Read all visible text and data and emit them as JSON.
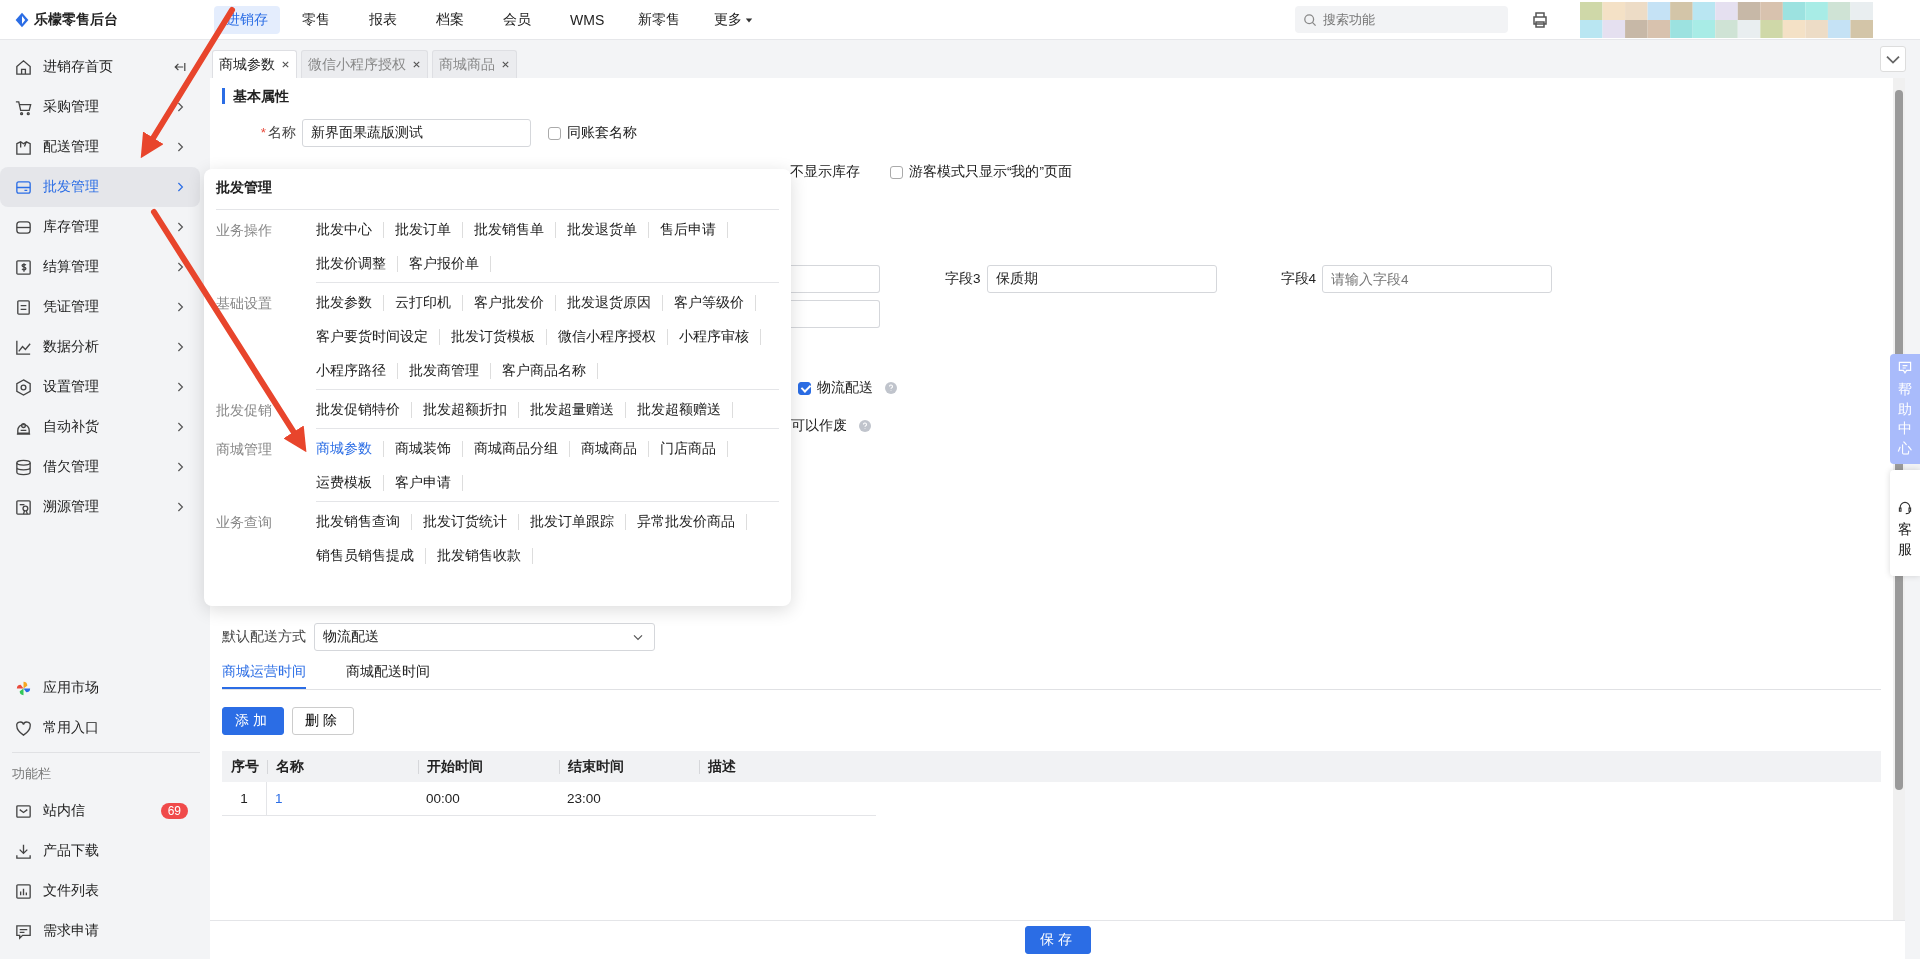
{
  "app": {
    "title": "乐檬零售后台"
  },
  "top_nav": [
    {
      "label": "进销存",
      "selected": true,
      "kind": "link"
    },
    {
      "label": "零售",
      "selected": false,
      "kind": "link"
    },
    {
      "label": "报表",
      "selected": false,
      "kind": "link"
    },
    {
      "label": "档案",
      "selected": false,
      "kind": "link"
    },
    {
      "label": "会员",
      "selected": false,
      "kind": "link"
    },
    {
      "label": "WMS",
      "selected": false,
      "kind": "link"
    },
    {
      "label": "新零售",
      "selected": false,
      "kind": "link"
    },
    {
      "label": "更多",
      "selected": false,
      "kind": "dropdown"
    }
  ],
  "search": {
    "placeholder": "搜索功能"
  },
  "sidebar": {
    "items": [
      {
        "label": "进销存首页",
        "selected": false
      },
      {
        "label": "采购管理",
        "selected": false
      },
      {
        "label": "配送管理",
        "selected": false
      },
      {
        "label": "批发管理",
        "selected": true
      },
      {
        "label": "库存管理",
        "selected": false
      },
      {
        "label": "结算管理",
        "selected": false
      },
      {
        "label": "凭证管理",
        "selected": false
      },
      {
        "label": "数据分析",
        "selected": false
      },
      {
        "label": "设置管理",
        "selected": false
      },
      {
        "label": "自动补货",
        "selected": false
      },
      {
        "label": "借欠管理",
        "selected": false
      },
      {
        "label": "溯源管理",
        "selected": false
      }
    ],
    "shortcuts": [
      {
        "label": "应用市场"
      },
      {
        "label": "常用入口"
      }
    ],
    "section_label": "功能栏",
    "tools": [
      {
        "label": "站内信",
        "badge": "69"
      },
      {
        "label": "产品下载"
      },
      {
        "label": "文件列表"
      },
      {
        "label": "需求申请"
      }
    ]
  },
  "page_tabs": [
    {
      "label": "商城参数",
      "selected": true
    },
    {
      "label": "微信小程序授权",
      "selected": false
    },
    {
      "label": "商城商品",
      "selected": false
    }
  ],
  "form": {
    "section_title": "基本属性",
    "name_field": {
      "label": "名称",
      "required_mark": "*",
      "value": "新界面果蔬版测试"
    },
    "same_name": {
      "label": "同账套名称",
      "checked": false
    },
    "hide_stock": {
      "label": "不显示库存"
    },
    "guest_mode": {
      "label": "游客模式只显示“我的”页面",
      "checked": false
    },
    "fields": [
      {
        "label": "字段3",
        "value": "保质期"
      },
      {
        "label": "字段4",
        "placeholder": "请输入字段4"
      }
    ],
    "logistics": {
      "label": "物流配送",
      "checked": true
    },
    "void_note": {
      "label": "可以作废"
    },
    "default_delivery": {
      "label": "默认配送方式",
      "value": "物流配送"
    },
    "time_tabs": [
      {
        "label": "商城运营时间",
        "selected": true
      },
      {
        "label": "商城配送时间",
        "selected": false
      }
    ],
    "buttons": {
      "add": "添加",
      "delete": "删除"
    },
    "table": {
      "columns": [
        "序号",
        "名称",
        "开始时间",
        "结束时间",
        "描述"
      ],
      "rows": [
        {
          "index": "1",
          "name": "1",
          "start": "00:00",
          "end": "23:00"
        }
      ]
    }
  },
  "popup": {
    "title": "批发管理",
    "groups": [
      {
        "label": "业务操作",
        "items": [
          {
            "label": "批发中心",
            "selected": false
          },
          {
            "label": "批发订单",
            "selected": false
          },
          {
            "label": "批发销售单",
            "selected": false
          },
          {
            "label": "批发退货单",
            "selected": false
          },
          {
            "label": "售后申请",
            "selected": false
          },
          {
            "label": "批发价调整",
            "selected": false
          },
          {
            "label": "客户报价单",
            "selected": false
          }
        ]
      },
      {
        "label": "基础设置",
        "items": [
          {
            "label": "批发参数",
            "selected": false
          },
          {
            "label": "云打印机",
            "selected": false
          },
          {
            "label": "客户批发价",
            "selected": false
          },
          {
            "label": "批发退货原因",
            "selected": false
          },
          {
            "label": "客户等级价",
            "selected": false
          },
          {
            "label": "客户要货时间设定",
            "selected": false
          },
          {
            "label": "批发订货模板",
            "selected": false
          },
          {
            "label": "微信小程序授权",
            "selected": false
          },
          {
            "label": "小程序审核",
            "selected": false
          },
          {
            "label": "小程序路径",
            "selected": false
          },
          {
            "label": "批发商管理",
            "selected": false
          },
          {
            "label": "客户商品名称",
            "selected": false
          }
        ]
      },
      {
        "label": "批发促销",
        "items": [
          {
            "label": "批发促销特价",
            "selected": false
          },
          {
            "label": "批发超额折扣",
            "selected": false
          },
          {
            "label": "批发超量赠送",
            "selected": false
          },
          {
            "label": "批发超额赠送",
            "selected": false
          }
        ]
      },
      {
        "label": "商城管理",
        "items": [
          {
            "label": "商城参数",
            "selected": true
          },
          {
            "label": "商城装饰",
            "selected": false
          },
          {
            "label": "商城商品分组",
            "selected": false
          },
          {
            "label": "商城商品",
            "selected": false
          },
          {
            "label": "门店商品",
            "selected": false
          },
          {
            "label": "运费模板",
            "selected": false
          },
          {
            "label": "客户申请",
            "selected": false
          }
        ]
      },
      {
        "label": "业务查询",
        "items": [
          {
            "label": "批发销售查询",
            "selected": false
          },
          {
            "label": "批发订货统计",
            "selected": false
          },
          {
            "label": "批发订单跟踪",
            "selected": false
          },
          {
            "label": "异常批发价商品",
            "selected": false
          },
          {
            "label": "销售员销售提成",
            "selected": false
          },
          {
            "label": "批发销售收款",
            "selected": false
          }
        ]
      }
    ]
  },
  "side_tabs": [
    {
      "label": "帮助中心",
      "kind": "help"
    },
    {
      "label": "客服",
      "kind": "service"
    }
  ],
  "footer": {
    "save": "保存"
  }
}
